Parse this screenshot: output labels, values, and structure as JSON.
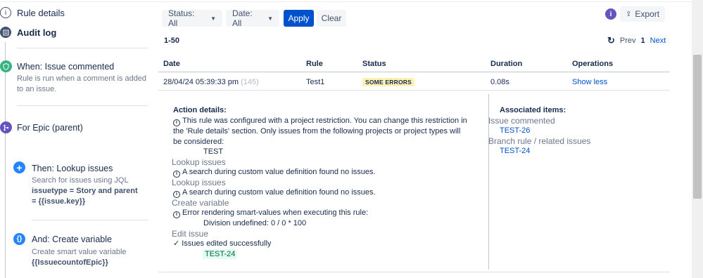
{
  "sidebar": {
    "rule_details": "Rule details",
    "audit_log": "Audit log",
    "trigger_title": "When: Issue commented",
    "trigger_desc": "Rule is run when a comment is added to an issue.",
    "branch_title": "For Epic (parent)",
    "lookup_title": "Then: Lookup issues",
    "lookup_desc": "Search for issues using JQL",
    "lookup_jql": "issuetype = Story and parent = {{issue.key}}",
    "var_title": "And: Create variable",
    "var_desc": "Create smart value variable",
    "var_name": "{{IssuecountofEpic}}"
  },
  "filters": {
    "status": "Status: All",
    "date": "Date: All",
    "apply": "Apply",
    "clear": "Clear",
    "export": "Export",
    "info": "i"
  },
  "pager": {
    "range": "1-50",
    "prev": "Prev",
    "current": "1",
    "next": "Next"
  },
  "table": {
    "headers": [
      "Date",
      "Rule",
      "Status",
      "Duration",
      "Operations"
    ],
    "row": {
      "date": "28/04/24 05:39:33 pm",
      "count": "(145)",
      "rule": "Test1",
      "status": "SOME ERRORS",
      "duration": "0.08s",
      "operation": "Show less"
    }
  },
  "details": {
    "action_heading": "Action details:",
    "restriction_msg": "This rule was configured with a project restriction. You can change this restriction in the 'Rule details' section. Only issues from the following projects or project types will be considered:",
    "project": "TEST",
    "lookup1_title": "Lookup issues",
    "lookup1_msg": "A search during custom value definition found no issues.",
    "lookup2_title": "Lookup issues",
    "lookup2_msg": "A search during custom value definition found no issues.",
    "create_var_title": "Create variable",
    "create_var_msg": "Error rendering smart-values when executing this rule:",
    "create_var_detail": "Division undefined: 0 / 0 * 100",
    "edit_title": "Edit issue",
    "edit_msg": "Issues edited successfully",
    "edit_issue": "TEST-24"
  },
  "associated": {
    "heading": "Associated items:",
    "issue_commented_label": "Issue commented",
    "issue_commented_key": "TEST-26",
    "branch_label": "Branch rule / related issues",
    "branch_key": "TEST-24"
  },
  "colors": {
    "primary": "#0052cc",
    "trigger": "#36b37e",
    "branch": "#6554c0",
    "action": "#2684ff",
    "warning_bg": "#fff0b3",
    "success_bg": "#e3fcef"
  }
}
